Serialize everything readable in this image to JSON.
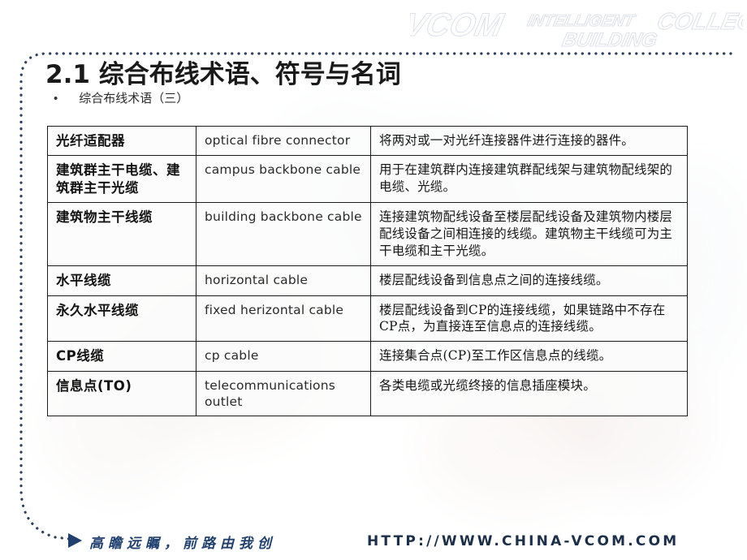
{
  "slide": {
    "title": "2.1 综合布线术语、符号与名词",
    "subtitle": "综合布线术语（三）",
    "bullet_glyph": "•"
  },
  "logo": {
    "word1": "VCOM",
    "word2": "INTELLIGENT",
    "word3": "BUILDING",
    "word4": "COLLEGE",
    "outline_color": "#dfe3ea"
  },
  "table": {
    "rows": [
      {
        "term_cn": "光纤适配器",
        "term_en": "optical fibre connector",
        "description": "将两对或一对光纤连接器件进行连接的器件。"
      },
      {
        "term_cn": "建筑群主干电缆、建筑群主干光缆",
        "term_en": "campus backbone cable",
        "description": "用于在建筑群内连接建筑群配线架与建筑物配线架的电缆、光缆。"
      },
      {
        "term_cn": "建筑物主干线缆",
        "term_en": "building backbone cable",
        "description": "连接建筑物配线设备至楼层配线设备及建筑物内楼层配线设备之间相连接的线缆。建筑物主干线缆可为主干电缆和主干光缆。"
      },
      {
        "term_cn": "水平线缆",
        "term_en": "horizontal cable",
        "description": "楼层配线设备到信息点之间的连接线缆。"
      },
      {
        "term_cn": "永久水平线缆",
        "term_en": "fixed herizontal cable",
        "description": "楼层配线设备到CP的连接线缆，如果链路中不存在CP点，为直接连至信息点的连接线缆。"
      },
      {
        "term_cn": "CP线缆",
        "term_en": "cp cable",
        "description": "连接集合点(CP)至工作区信息点的线缆。"
      },
      {
        "term_cn": "信息点(TO)",
        "term_en": "telecommunications outlet",
        "description": "各类电缆或光缆终接的信息插座模块。"
      }
    ]
  },
  "footer": {
    "slogan": "高瞻远瞩，前路由我创",
    "url": "HTTP://WWW.CHINA-VCOM.COM",
    "accent_color": "#20406f"
  }
}
